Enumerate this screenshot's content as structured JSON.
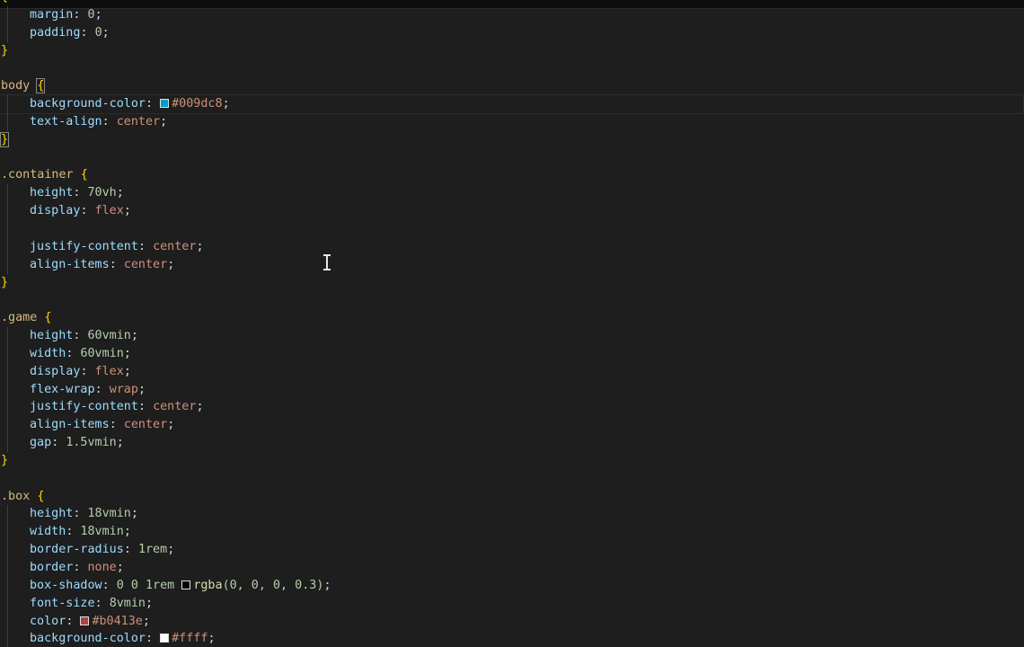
{
  "colors": {
    "selector": "#d7ba7d",
    "property": "#9cdcfe",
    "value": "#ce9178",
    "number": "#b5cea8",
    "brace": "#ffd700",
    "background": "#1e1e1e"
  },
  "code": {
    "l1": {
      "prop": "margin",
      "colon": ": ",
      "value": "0",
      "end": ";"
    },
    "l2": {
      "prop": "padding",
      "colon": ": ",
      "value": "0",
      "end": ";"
    },
    "l3": {
      "brace": "}"
    },
    "l5": {
      "selector": "body",
      "brace": "{"
    },
    "l6": {
      "prop": "background-color",
      "colon": ": ",
      "swatch": "#009dc8",
      "value": "#009dc8",
      "end": ";"
    },
    "l7": {
      "prop": "text-align",
      "colon": ": ",
      "value": "center",
      "end": ";"
    },
    "l8": {
      "brace": "}"
    },
    "l10": {
      "selector": ".container",
      "brace": "{"
    },
    "l11": {
      "prop": "height",
      "colon": ": ",
      "value": "70vh",
      "end": ";"
    },
    "l12": {
      "prop": "display",
      "colon": ": ",
      "value": "flex",
      "end": ";"
    },
    "l14": {
      "prop": "justify-content",
      "colon": ": ",
      "value": "center",
      "end": ";"
    },
    "l15": {
      "prop": "align-items",
      "colon": ": ",
      "value": "center",
      "end": ";"
    },
    "l16": {
      "brace": "}"
    },
    "l18": {
      "selector": ".game",
      "brace": "{"
    },
    "l19": {
      "prop": "height",
      "colon": ": ",
      "value": "60vmin",
      "end": ";"
    },
    "l20": {
      "prop": "width",
      "colon": ": ",
      "value": "60vmin",
      "end": ";"
    },
    "l21": {
      "prop": "display",
      "colon": ": ",
      "value": "flex",
      "end": ";"
    },
    "l22": {
      "prop": "flex-wrap",
      "colon": ": ",
      "value": "wrap",
      "end": ";"
    },
    "l23": {
      "prop": "justify-content",
      "colon": ": ",
      "value": "center",
      "end": ";"
    },
    "l24": {
      "prop": "align-items",
      "colon": ": ",
      "value": "center",
      "end": ";"
    },
    "l25": {
      "prop": "gap",
      "colon": ": ",
      "value": "1.5vmin",
      "end": ";"
    },
    "l26": {
      "brace": "}"
    },
    "l28": {
      "selector": ".box",
      "brace": "{"
    },
    "l29": {
      "prop": "height",
      "colon": ": ",
      "value": "18vmin",
      "end": ";"
    },
    "l30": {
      "prop": "width",
      "colon": ": ",
      "value": "18vmin",
      "end": ";"
    },
    "l31": {
      "prop": "border-radius",
      "colon": ": ",
      "value": "1rem",
      "end": ";"
    },
    "l32": {
      "prop": "border",
      "colon": ": ",
      "value": "none",
      "end": ";"
    },
    "l33": {
      "prop": "box-shadow",
      "colon": ": ",
      "pre": "0 0 1rem ",
      "swatch": "#000000",
      "fn": "rgba",
      "args": "(0, 0, 0, 0.3)",
      "end": ";"
    },
    "l34": {
      "prop": "font-size",
      "colon": ": ",
      "value": "8vmin",
      "end": ";"
    },
    "l35": {
      "prop": "color",
      "colon": ": ",
      "swatch": "#b0413e",
      "value": "#b0413e",
      "end": ";"
    },
    "l36": {
      "prop": "background-color",
      "colon": ": ",
      "swatch": "#ffffff",
      "value": "#ffff",
      "end": ";"
    }
  }
}
